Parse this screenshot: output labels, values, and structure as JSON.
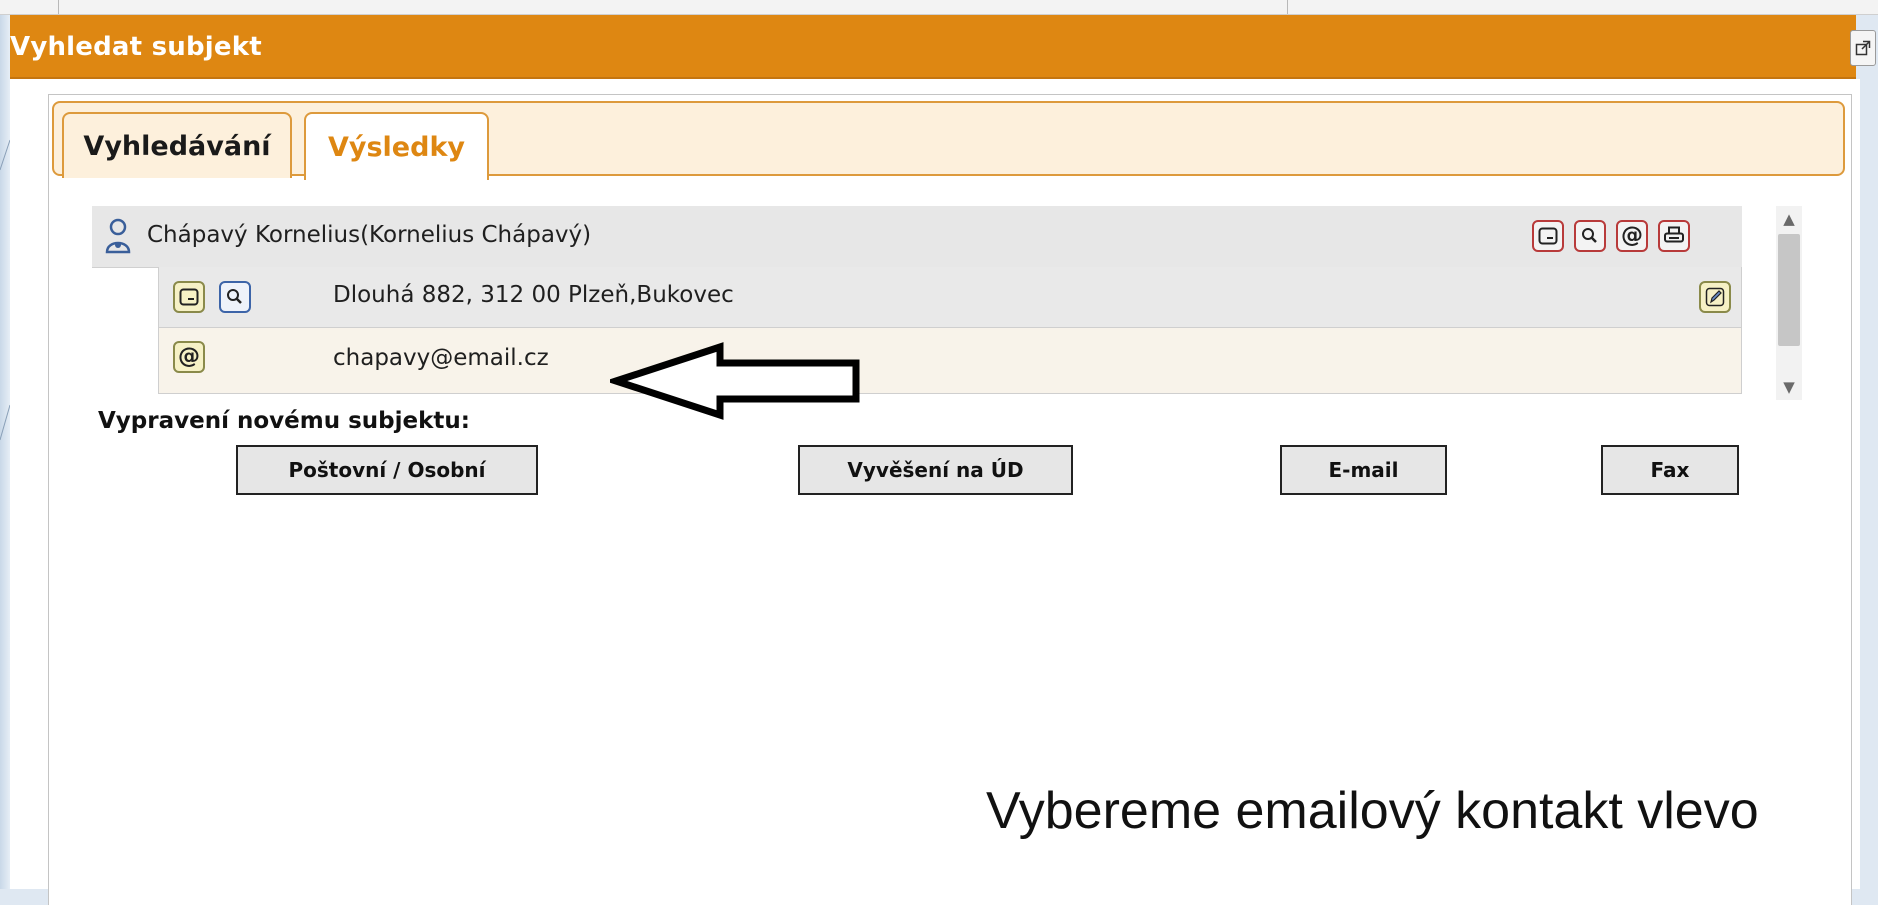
{
  "window": {
    "title": "Vyhledat subjekt"
  },
  "tabs": [
    {
      "label": "Vyhledávání",
      "active": false
    },
    {
      "label": "Výsledky",
      "active": true
    }
  ],
  "results": {
    "subject": {
      "name": "Chápavý Kornelius(Kornelius Chápavý)",
      "icon": "person-icon",
      "action_icons": [
        "card-icon",
        "search-icon",
        "email-at-icon",
        "print-icon"
      ]
    },
    "address": {
      "text": "Dlouhá 882, 312 00 Plzeň,Bukovec",
      "action_icons": [
        "card-icon",
        "search-icon"
      ],
      "edit_icon": "edit-pencil-icon"
    },
    "email": {
      "text": "chapavy@email.cz",
      "icon": "email-at-icon"
    }
  },
  "dispatch": {
    "label": "Vypravení novému subjektu:",
    "buttons": [
      {
        "label": "Poštovní / Osobní"
      },
      {
        "label": "Vyvěšení na ÚD"
      },
      {
        "label": "E-mail"
      },
      {
        "label": "Fax"
      }
    ]
  },
  "caption": "Vybereme emailový kontakt vlevo",
  "colors": {
    "header": "#de8712",
    "tab_active_text": "#de8712",
    "tab_border": "#dd9a3c",
    "tab_strip_bg": "#fdf0dc"
  }
}
